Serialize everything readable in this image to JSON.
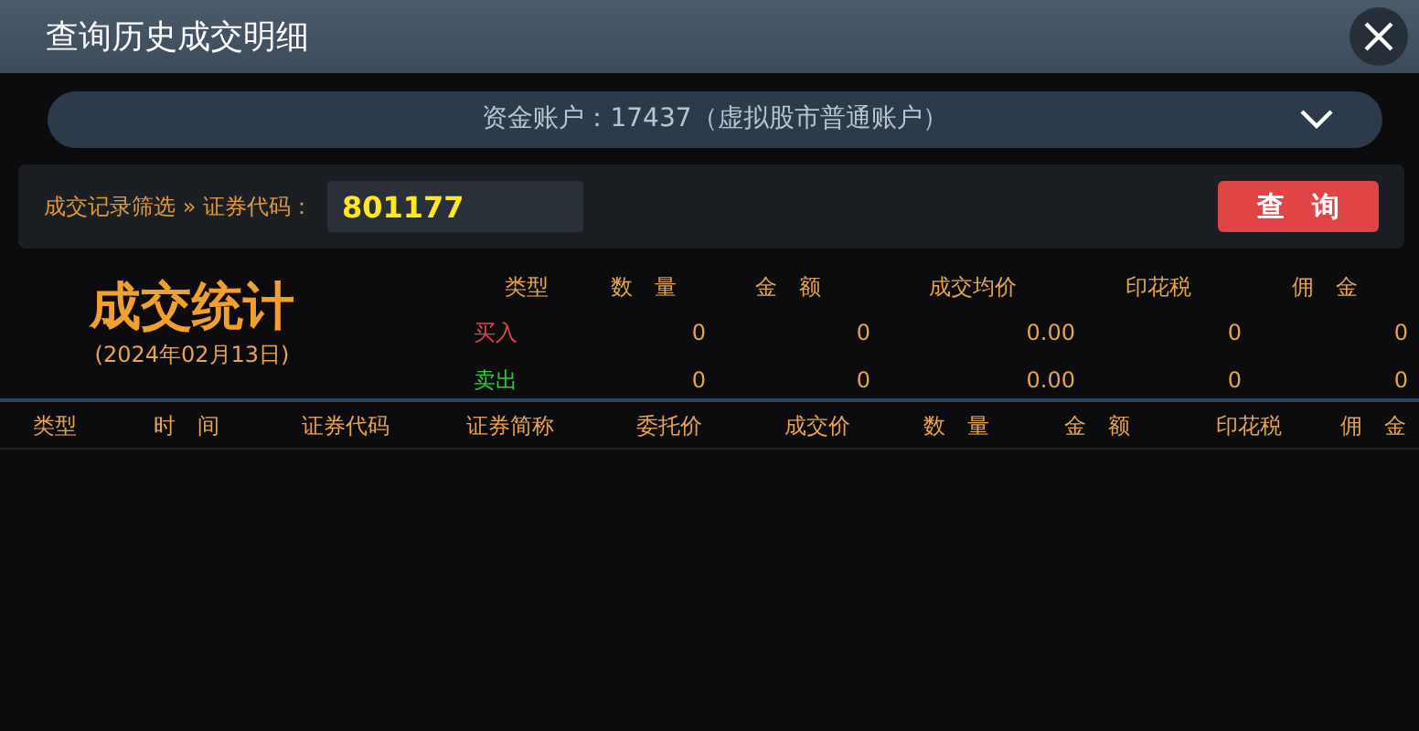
{
  "window": {
    "title": "查询历史成交明细"
  },
  "account": {
    "label": "资金账户：17437（虚拟股市普通账户）"
  },
  "filter": {
    "label": "成交记录筛选 » 证券代码：",
    "code": "801177",
    "button": "查 询"
  },
  "stats": {
    "title": "成交统计",
    "date": "(2024年02月13日)",
    "columns": [
      "类型",
      "数 量",
      "金 额",
      "成交均价",
      "印花税",
      "佣 金"
    ],
    "rows": [
      {
        "kind": "buy",
        "cells": [
          "买入",
          "0",
          "0",
          "0.00",
          "0",
          "0"
        ]
      },
      {
        "kind": "sell",
        "cells": [
          "卖出",
          "0",
          "0",
          "0.00",
          "0",
          "0"
        ]
      }
    ]
  },
  "table": {
    "columns": [
      "类型",
      "时 间",
      "证券代码",
      "证券简称",
      "委托价",
      "成交价",
      "数 量",
      "金 额",
      "印花税",
      "佣 金"
    ]
  }
}
